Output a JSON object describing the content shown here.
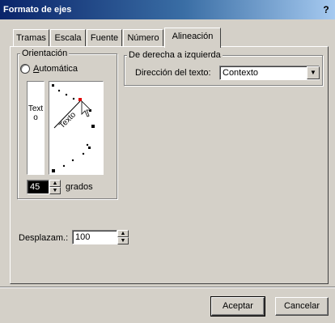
{
  "window": {
    "title": "Formato de ejes",
    "help_glyph": "?"
  },
  "tabs": [
    {
      "label": "Tramas"
    },
    {
      "label": "Escala"
    },
    {
      "label": "Fuente"
    },
    {
      "label": "Número"
    },
    {
      "label": "Alineación",
      "active": true
    }
  ],
  "orientation": {
    "group_label": "Orientación",
    "radio_label": "Automática",
    "vertical_text": "Texto",
    "rotated_text": "Texto",
    "degrees_value": "45",
    "degrees_label": "grados"
  },
  "direction": {
    "group_label": "De derecha a izquierda",
    "field_label": "Dirección del texto:",
    "selected": "Contexto"
  },
  "offset": {
    "label": "Desplazam.:",
    "value": "100"
  },
  "footer": {
    "ok_label": "Aceptar",
    "cancel_label": "Cancelar"
  },
  "colors": {
    "titlebar_start": "#0a246a",
    "titlebar_end": "#a6caf0",
    "dial_marker": "#e00000",
    "face": "#d4d0c8"
  }
}
